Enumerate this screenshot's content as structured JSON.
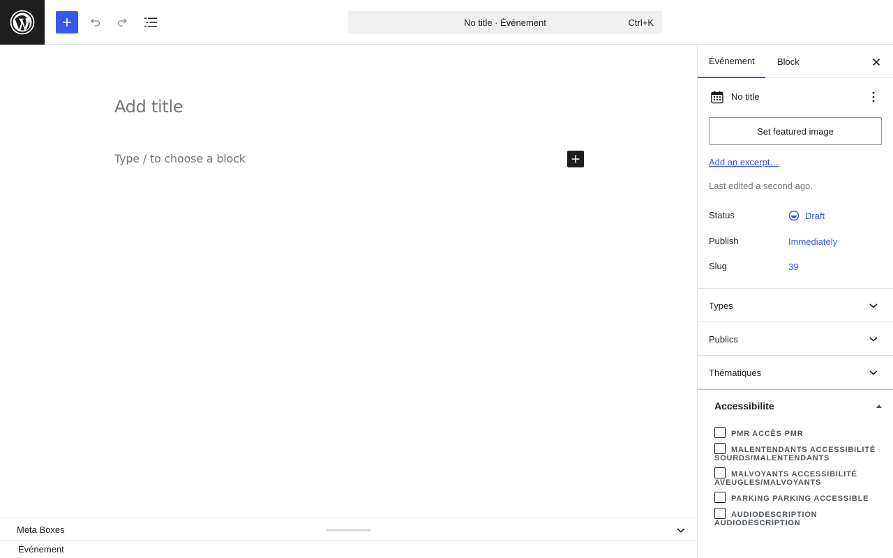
{
  "toolbar": {
    "command_bar_text": "No title · Événement",
    "command_bar_shortcut": "Ctrl+K"
  },
  "editor": {
    "title_placeholder": "Add title",
    "block_placeholder": "Type / to choose a block"
  },
  "sidebar": {
    "tabs": [
      {
        "label": "Événement",
        "active": true
      },
      {
        "label": "Block",
        "active": false
      }
    ],
    "post_title": "No title",
    "featured_image_button": "Set featured image",
    "excerpt_link": "Add an excerpt…",
    "last_edited": "Last edited a second ago.",
    "rows": [
      {
        "label": "Status",
        "value": "Draft"
      },
      {
        "label": "Publish",
        "value": "Immediately"
      },
      {
        "label": "Slug",
        "value": "39"
      }
    ],
    "panels": [
      {
        "title": "Types"
      },
      {
        "title": "Publics"
      },
      {
        "title": "Thématiques"
      }
    ],
    "accessibilite": {
      "title": "Accessibilite",
      "items": [
        "PMR Accès PMR",
        "malentendants Accessibilité sourds/malentendants",
        "malvoyants Accessibilité aveugles/malvoyants",
        "parking Parking accessible",
        "audiodescription Audiodescription"
      ]
    }
  },
  "meta_boxes": {
    "label": "Meta Boxes"
  },
  "breadcrumb": {
    "label": "Événement"
  },
  "colors": {
    "accent": "#3858e9",
    "dark": "#1e1e1e",
    "muted": "#757575"
  }
}
